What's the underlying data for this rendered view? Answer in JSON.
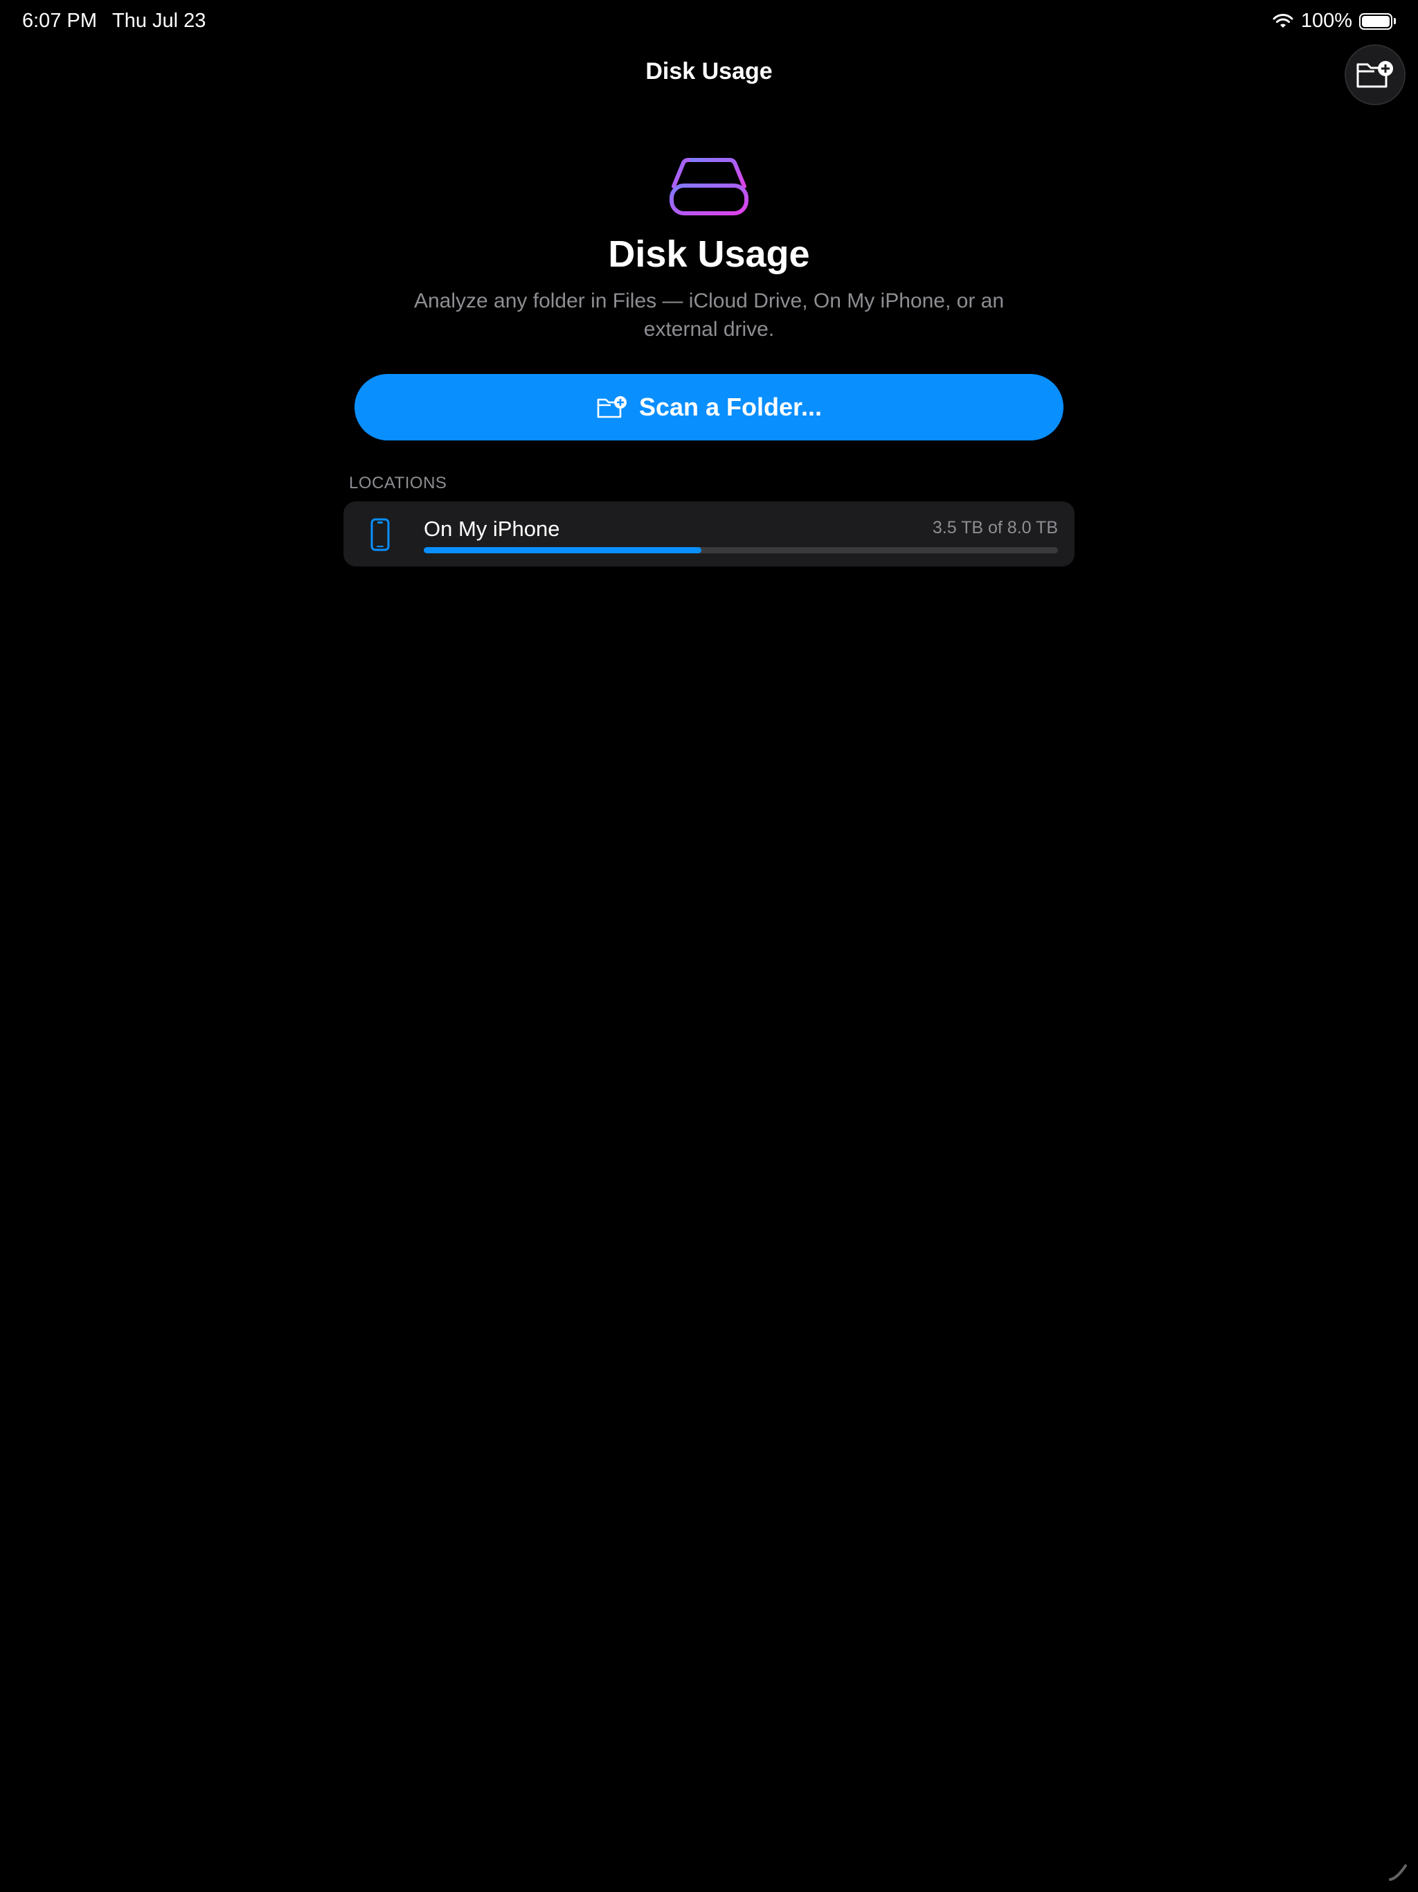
{
  "status_bar": {
    "time": "6:07 PM",
    "date": "Thu Jul 23",
    "battery_percent": "100%",
    "battery_level": 1.0
  },
  "nav": {
    "title": "Disk Usage",
    "action_icon": "folder-badge-plus-icon"
  },
  "hero": {
    "icon": "internaldrive-icon",
    "title": "Disk Usage",
    "subtitle": "Analyze any folder in Files — iCloud Drive, On My iPhone, or an external drive."
  },
  "scan_button": {
    "label": "Scan a Folder...",
    "icon": "folder-badge-plus-icon"
  },
  "locations": {
    "header": "LOCATIONS",
    "items": [
      {
        "name": "On My iPhone",
        "icon": "iphone-icon",
        "usage_text": "3.5 TB of 8.0 TB",
        "used_fraction": 0.4375
      }
    ]
  },
  "colors": {
    "accent": "#0a8fff",
    "background": "#000000",
    "card": "#1c1c1e",
    "secondary_text": "#8e8e93",
    "icon_gradient_start": "#7f7cff",
    "icon_gradient_end": "#e040e8"
  }
}
